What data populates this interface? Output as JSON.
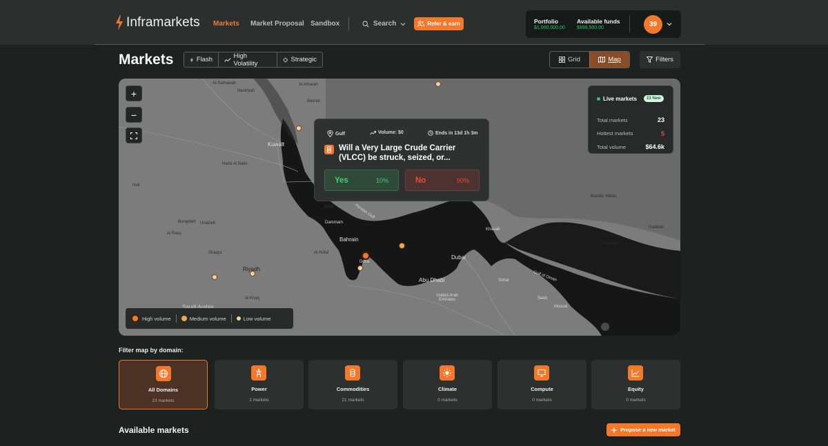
{
  "brand": {
    "name": "Inframarkets",
    "accent": "#f4782b"
  },
  "nav": [
    {
      "label": "Markets",
      "active": true
    },
    {
      "label": "Market Proposal",
      "active": false
    },
    {
      "label": "Sandbox",
      "active": false
    }
  ],
  "search": {
    "label": "Search"
  },
  "refer": {
    "label": "Refer & earn"
  },
  "account": {
    "portfolio_label": "Portfolio",
    "portfolio_value": "$1,000,000.00",
    "funds_label": "Available funds",
    "funds_value": "$999,500.00",
    "avatar": "39"
  },
  "page": {
    "title": "Markets"
  },
  "segments": [
    {
      "label": "Flash",
      "icon": "bolt-icon"
    },
    {
      "label": "High Volatility",
      "icon": "trend-icon"
    },
    {
      "label": "Strategic",
      "icon": "target-icon"
    }
  ],
  "views": {
    "grid": "Grid",
    "map": "Map",
    "active": "Map"
  },
  "filters": {
    "label": "Filters"
  },
  "map": {
    "labels": [
      "Al-Samawah",
      "Nasiriyah",
      "Al Amarah",
      "Basrah",
      "Kuwait",
      "Hafar Al Batin",
      "Hail",
      "Buraydah",
      "Unaizah",
      "Al Rass",
      "Shaqra",
      "Riyadh",
      "Al Kharj",
      "Jubail",
      "Dammam",
      "Bahrain",
      "Al Hofuf",
      "Doha",
      "Dubai",
      "Abu Dhabi",
      "United Arab Emirates",
      "Khasab",
      "Sohar",
      "Seeb",
      "Muscat",
      "Gulf of Oman",
      "Persian Gulf",
      "Bandar Abbas",
      "Saudi Arabia",
      "Hadibah",
      "Al Qasab"
    ],
    "controls": {
      "zoom_in": "+",
      "zoom_out": "−"
    }
  },
  "popup": {
    "region": "Gulf",
    "volume": "Volume: $0",
    "ends": "Ends in 13d 1h 3m",
    "title": "Will a Very Large Crude Carrier (VLCC) be struck, seized, or...",
    "yes_label": "Yes",
    "yes_pct": "10%",
    "no_label": "No",
    "no_pct": "90%"
  },
  "live": {
    "title": "Live markets",
    "badge": "23 New",
    "total_label": "Total markets",
    "total_value": "23",
    "hottest_label": "Hottest markets",
    "hottest_value": "5",
    "volume_label": "Total volume",
    "volume_value": "$64.6k"
  },
  "legend": {
    "high": "High volume",
    "medium": "Medium volume",
    "low": "Low volume"
  },
  "domains": {
    "title": "Filter map by domain:",
    "items": [
      {
        "name": "All Domains",
        "count": "23 markets",
        "icon": "globe-icon"
      },
      {
        "name": "Power",
        "count": "2 markets",
        "icon": "power-tower-icon"
      },
      {
        "name": "Commodities",
        "count": "21 markets",
        "icon": "barrel-icon"
      },
      {
        "name": "Climate",
        "count": "0 markets",
        "icon": "sun-icon"
      },
      {
        "name": "Compute",
        "count": "0 markets",
        "icon": "monitor-icon"
      },
      {
        "name": "Equity",
        "count": "0 markets",
        "icon": "chart-icon"
      }
    ]
  },
  "available": {
    "title": "Available markets",
    "propose": "Propose a new market"
  }
}
